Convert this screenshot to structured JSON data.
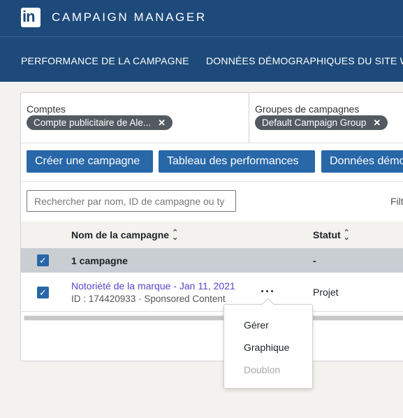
{
  "header": {
    "logo_text": "in",
    "app_title": "CAMPAIGN MANAGER"
  },
  "subnav": {
    "tabs": [
      {
        "label": "PERFORMANCE DE LA CAMPAGNE"
      },
      {
        "label": "DONNÉES DÉMOGRAPHIQUES DU SITE WE"
      }
    ]
  },
  "filters": {
    "accounts": {
      "label": "Comptes",
      "chip": "Compte publicitaire de Ale..."
    },
    "campaign_groups": {
      "label": "Groupes de campagnes",
      "chip": "Default Campaign Group"
    }
  },
  "toolbar": {
    "create_label": "Créer une campagne",
    "performance_label": "Tableau des performances",
    "demographics_label": "Données démo"
  },
  "search": {
    "placeholder": "Rechercher par nom, ID de campagne ou ty",
    "filter_label": "Filt"
  },
  "table": {
    "columns": [
      {
        "label": "Nom de la campagne"
      },
      {
        "label": "Statut"
      }
    ],
    "summary": {
      "label": "1 campagne",
      "status": "-"
    },
    "rows": [
      {
        "name": "Notoriété de la marque - Jan 11, 2021",
        "meta": "ID : 174420933 · Sponsored Content",
        "status": "Projet"
      }
    ]
  },
  "context_menu": {
    "items": [
      {
        "label": "Gérer",
        "enabled": true
      },
      {
        "label": "Graphique",
        "enabled": true
      },
      {
        "label": "Doublon",
        "enabled": false
      }
    ]
  },
  "colors": {
    "header_bg": "#1d4a7a",
    "button_bg": "#2867a8",
    "link": "#5747c6",
    "chip_bg": "#535a61"
  }
}
